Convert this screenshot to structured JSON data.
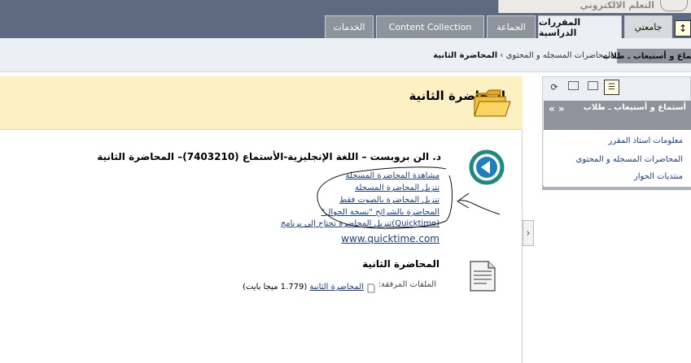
{
  "banner": {
    "text": "التعلم الالكتروني"
  },
  "tabs": [
    {
      "label": "جامعتي"
    },
    {
      "label": "المقررات الدراسية"
    },
    {
      "label": "الجماعة"
    },
    {
      "label": "Content Collection"
    },
    {
      "label": "الخدمات"
    }
  ],
  "toggle": {
    "symbol": "↕"
  },
  "course_tab": {
    "label": "أستماع و أستيعاب ـ طلاب"
  },
  "breadcrumb": {
    "parent": "المحاضرات المسجله و المحتوى",
    "separator": "›",
    "current": "المحاضرة الثانية"
  },
  "page": {
    "title": "المحاضرة الثانية"
  },
  "item1": {
    "title": "د. الن بروبست – اللغة الإنجليزية-الأستماع (7403210)– المحاضرة الثانية",
    "links": [
      "مشاهدة المحاضرة المسجلة",
      "تنزيل المحاضرة المسجلة",
      "تنزيل المحاضرة بالصوت فقط",
      "المحاضرة بالشرائح \"نسخة الجوال\"",
      "(Quicktime)تنزيل المحاضرة تحتاج إلى برنامج",
      "www.quicktime.com"
    ]
  },
  "item2": {
    "title": "المحاضرة الثانية",
    "attachments_label": "الملفات المرفقة:",
    "attachment_name": "المحاضرة الثانية",
    "attachment_size": "(1.779 ميجا بايت)"
  },
  "collapse": {
    "symbol": "›"
  },
  "sidebar": {
    "course_title": "أستماع و أستيعاب ـ طلاب",
    "arrows": "« »",
    "items": [
      "معلومات استاذ المقرر",
      "المحاضرات المسجله و المحتوى",
      "منتديات الحوار"
    ]
  },
  "colors": {
    "top_band": "#5e6a80",
    "tab_inactive": "#8e949c",
    "header_yellow": "#fdf1c4",
    "link": "#1a3c8a",
    "play_teal": "#1c8a80"
  }
}
